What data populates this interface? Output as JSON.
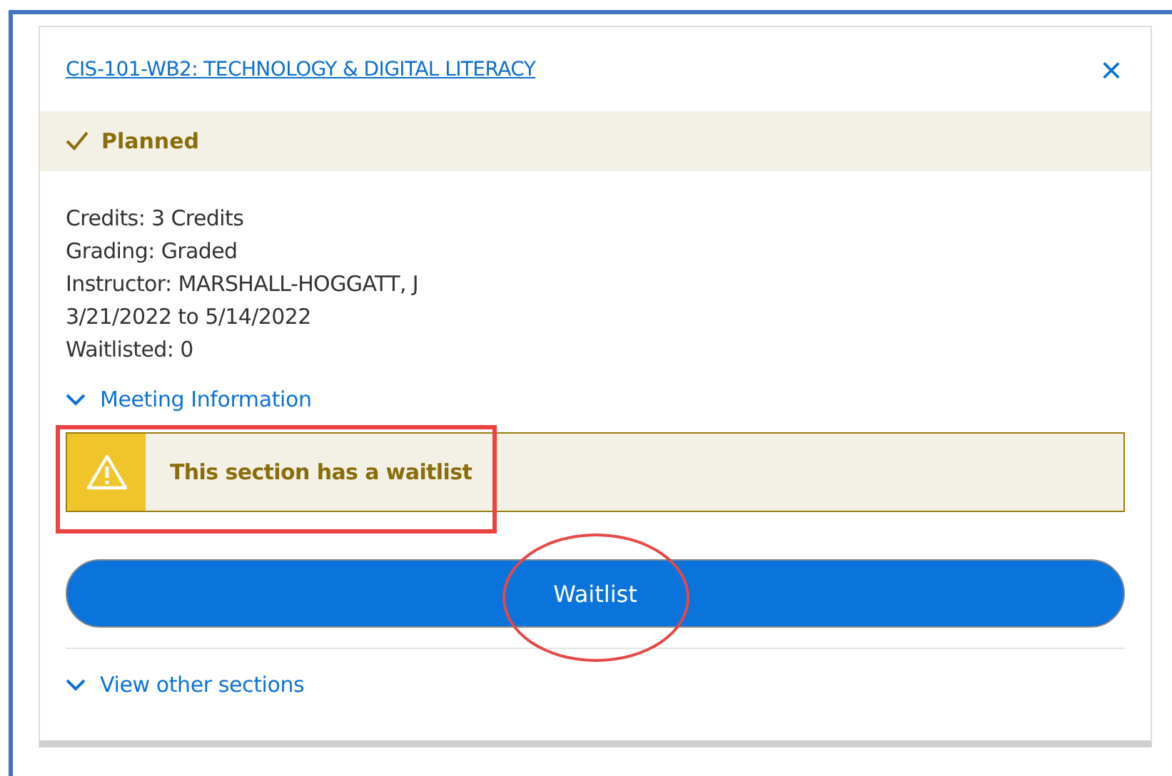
{
  "course": {
    "title": "CIS-101-WB2: TECHNOLOGY & DIGITAL LITERACY",
    "close": "×"
  },
  "status": {
    "label": "Planned",
    "checked": true
  },
  "details": [
    "Credits: 3 Credits",
    "Grading: Graded",
    "Instructor: MARSHALL-HOGGATT, J",
    "3/21/2022 to 5/14/2022",
    "Waitlisted:  0"
  ],
  "meeting_toggle": {
    "label": "Meeting Information",
    "expanded": false
  },
  "alert": {
    "message": "This section has a waitlist"
  },
  "action_button": {
    "label": "Waitlist"
  },
  "other_sections_toggle": {
    "label": "View other sections",
    "expanded": false
  },
  "annotations": [
    {
      "kind": "rectangle"
    },
    {
      "kind": "ellipse"
    }
  ]
}
